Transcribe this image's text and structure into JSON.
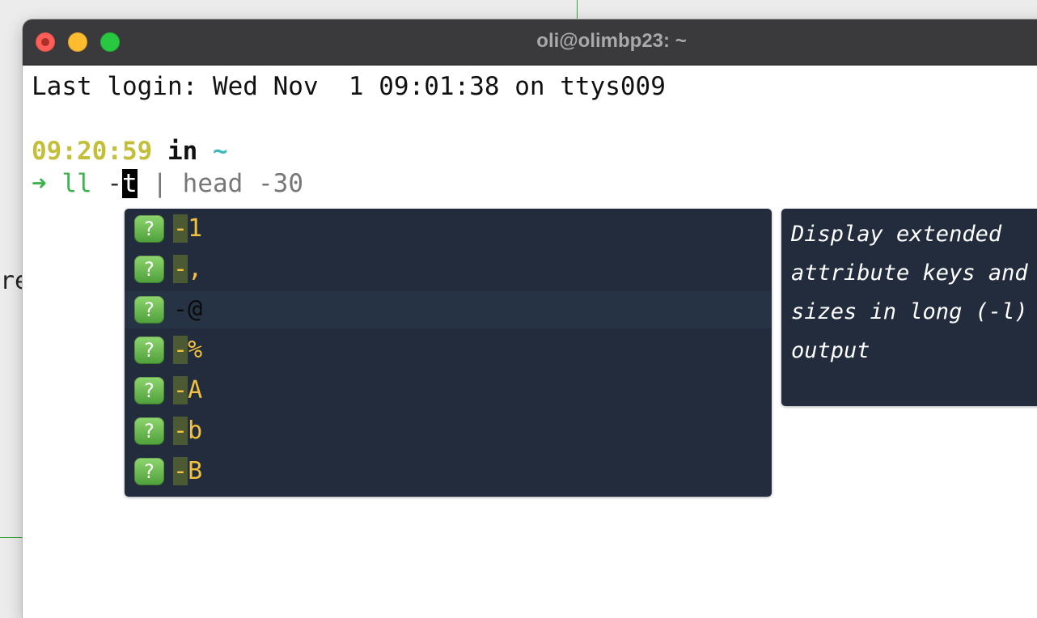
{
  "window": {
    "title": "oli@olimbp23: ~"
  },
  "background": {
    "partial_text": "re"
  },
  "terminal": {
    "last_login": "Last login: Wed Nov  1 09:01:38 on ttys009",
    "prompt": {
      "time": "09:20:59",
      "in_word": "in",
      "directory": "~"
    },
    "command": {
      "arrow": "➜",
      "cmd": "ll",
      "option_dash": "-",
      "cursor_char": "t",
      "rest": " | head -30"
    }
  },
  "completion": {
    "icon_glyph": "?",
    "icon_name": "question-icon",
    "items": [
      {
        "dash": "-",
        "label": "1"
      },
      {
        "dash": "-",
        "label": ","
      },
      {
        "dash": "-",
        "label": "@"
      },
      {
        "dash": "-",
        "label": "%"
      },
      {
        "dash": "-",
        "label": "A"
      },
      {
        "dash": "-",
        "label": "b"
      },
      {
        "dash": "-",
        "label": "B"
      }
    ],
    "selected_index": 2,
    "description": "Display extended attribute keys and sizes in long (-l) output"
  },
  "colors": {
    "time": "#c3bf3a",
    "directory": "#45b8b8",
    "command": "#3cb44b",
    "popup_bg": "#222c3c",
    "option_text": "#f2c13d"
  }
}
